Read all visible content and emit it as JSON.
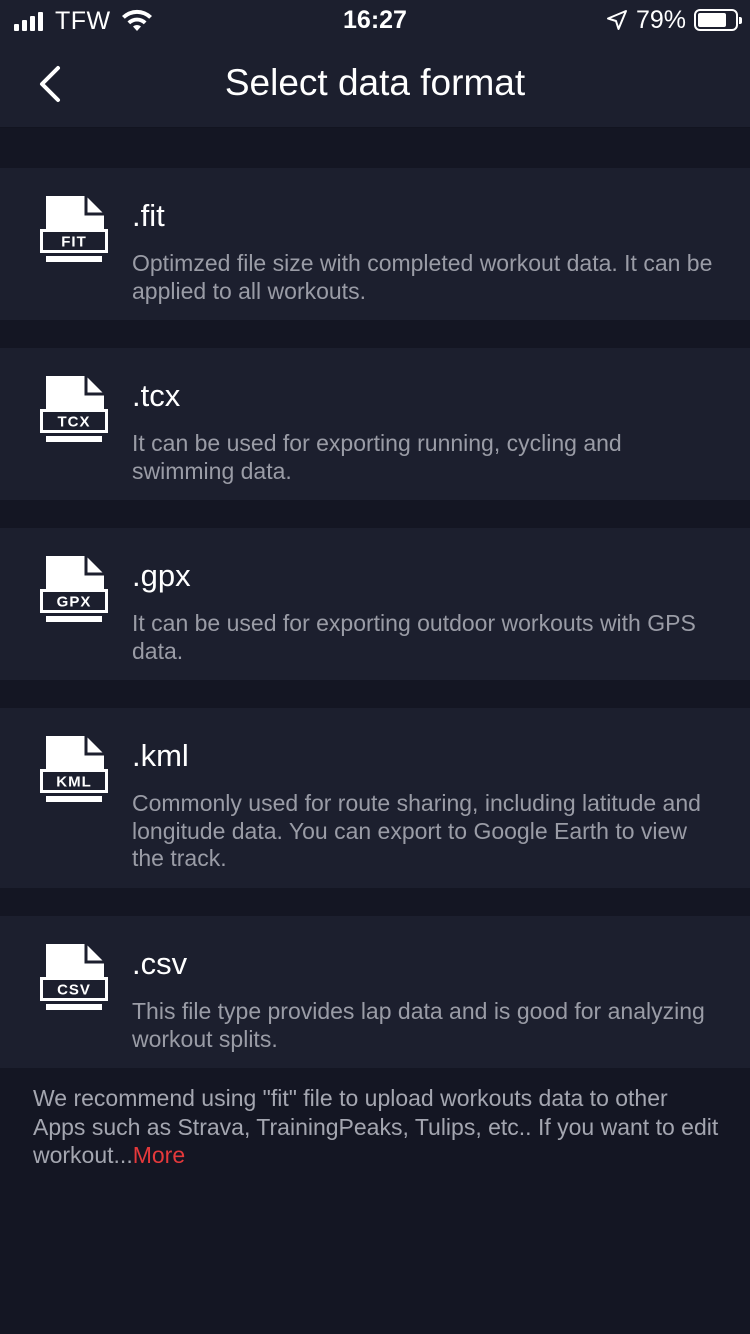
{
  "status_bar": {
    "carrier": "TFW",
    "time": "16:27",
    "battery_percent": "79%",
    "battery_level": 0.79,
    "signal_icon": "cellular-signal-icon",
    "wifi_icon": "wifi-icon",
    "location_icon": "location-arrow-icon",
    "battery_icon": "battery-icon"
  },
  "header": {
    "back_icon": "chevron-left-icon",
    "title": "Select data format"
  },
  "formats": [
    {
      "icon_label": "FIT",
      "title": ".fit",
      "description": "Optimzed file size with completed workout data. It can be applied to all workouts."
    },
    {
      "icon_label": "TCX",
      "title": ".tcx",
      "description": "It can be used for exporting running, cycling and swimming data."
    },
    {
      "icon_label": "GPX",
      "title": ".gpx",
      "description": "It can be used for exporting outdoor workouts with GPS data."
    },
    {
      "icon_label": "KML",
      "title": ".kml",
      "description": "Commonly used for route sharing, including latitude and longitude data. You can export to Google Earth to view the track."
    },
    {
      "icon_label": "CSV",
      "title": ".csv",
      "description": "This file type provides lap data and is good for analyzing workout splits."
    }
  ],
  "footer": {
    "note": "We recommend using \"fit\" file to upload workouts data to other Apps such as Strava, TrainingPeaks, Tulips, etc.. If you want to edit workout...",
    "more_label": "More",
    "more_color": "#e5393b"
  },
  "colors": {
    "background": "#141623",
    "card": "#1c1f2e",
    "description_text": "#9a9ca6",
    "accent": "#e5393b"
  }
}
